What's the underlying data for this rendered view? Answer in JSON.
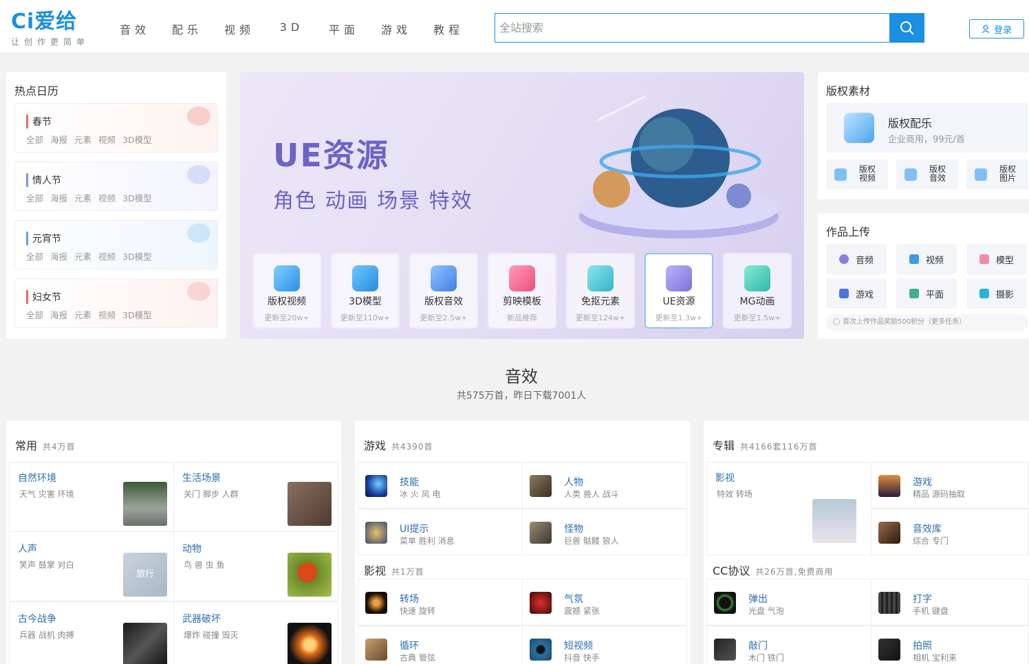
{
  "header": {
    "logo_text": "Ci爱给",
    "logo_sub": "让创作更简单",
    "nav": [
      "音效",
      "配乐",
      "视频",
      "3D",
      "平面",
      "游戏",
      "教程"
    ],
    "search_placeholder": "全站搜索",
    "login": "登录"
  },
  "calendar": {
    "title": "热点日历",
    "items": [
      {
        "name": "春节",
        "color": "#e66"
      },
      {
        "name": "情人节",
        "color": "#7a9bd8"
      },
      {
        "name": "元宵节",
        "color": "#5aa5e0"
      },
      {
        "name": "妇女节",
        "color": "#e66"
      }
    ],
    "links": [
      "全部",
      "海报",
      "元素",
      "视频",
      "3D模型"
    ]
  },
  "banner": {
    "title": "UE资源",
    "subtitle": "角色 动画 场景 特效",
    "features": [
      {
        "label": "版权视频",
        "sub": "更新至20w+"
      },
      {
        "label": "3D模型",
        "sub": "更新至110w+"
      },
      {
        "label": "版权音效",
        "sub": "更新至2.5w+"
      },
      {
        "label": "剪映模板",
        "sub": "新品推荐"
      },
      {
        "label": "免抠元素",
        "sub": "更新至124w+"
      },
      {
        "label": "UE资源",
        "sub": "更新至1.3w+"
      },
      {
        "label": "MG动画",
        "sub": "更新至1.5w+"
      }
    ]
  },
  "copyright": {
    "title": "版权素材",
    "main_title": "版权配乐",
    "main_sub": "企业商用，99元/首",
    "items": [
      "版权视频",
      "版权音效",
      "版权图片"
    ]
  },
  "upload": {
    "title": "作品上传",
    "items": [
      "音频",
      "视频",
      "模型",
      "游戏",
      "平面",
      "摄影"
    ],
    "note": "首次上传作品奖励500积分（更多任务）"
  },
  "section": {
    "title": "音效",
    "sub": "共575万首，昨日下载7001人"
  },
  "common": {
    "title": "常用",
    "count": "共4万首",
    "cells": [
      {
        "title": "自然环境",
        "tags": "天气 灾害 环境"
      },
      {
        "title": "生活场景",
        "tags": "关门 脚步 人群"
      },
      {
        "title": "人声",
        "tags": "笑声 鼓掌 对白"
      },
      {
        "title": "动物",
        "tags": "鸟 兽 虫 鱼"
      },
      {
        "title": "古今战争",
        "tags": "兵器 战机 肉搏"
      },
      {
        "title": "武器破坏",
        "tags": "爆炸 碰撞 毁灭"
      }
    ],
    "thumb_text": "旅行"
  },
  "game": {
    "title": "游戏",
    "count": "共4390首",
    "rows": [
      {
        "title": "技能",
        "tags": "冰 火 风 电"
      },
      {
        "title": "人物",
        "tags": "人类 兽人 战斗"
      },
      {
        "title": "UI提示",
        "tags": "菜单 胜利 消息"
      },
      {
        "title": "怪物",
        "tags": "巨兽 骷髅 狼人"
      }
    ]
  },
  "film": {
    "title": "影视",
    "count": "共1万首",
    "rows": [
      {
        "title": "转场",
        "tags": "快速 旋转"
      },
      {
        "title": "气氛",
        "tags": "震撼 紧张"
      },
      {
        "title": "循环",
        "tags": "古典 管弦"
      },
      {
        "title": "短视频",
        "tags": "抖音 快手"
      }
    ]
  },
  "album": {
    "title": "专辑",
    "count": "共4166套116万首",
    "main": {
      "title": "影视",
      "tags": "特效 转场"
    },
    "rows": [
      {
        "title": "游戏",
        "tags": "精品 源码抽取"
      },
      {
        "title": "音效库",
        "tags": "综合 专门"
      }
    ]
  },
  "cc": {
    "title": "CC协议",
    "count": "共26万首,免费商用",
    "rows": [
      {
        "title": "弹出",
        "tags": "光盘 气泡"
      },
      {
        "title": "打字",
        "tags": "手机 键盘"
      },
      {
        "title": "敲门",
        "tags": "木门 铁门"
      },
      {
        "title": "拍照",
        "tags": "相机 宝利来"
      }
    ]
  }
}
